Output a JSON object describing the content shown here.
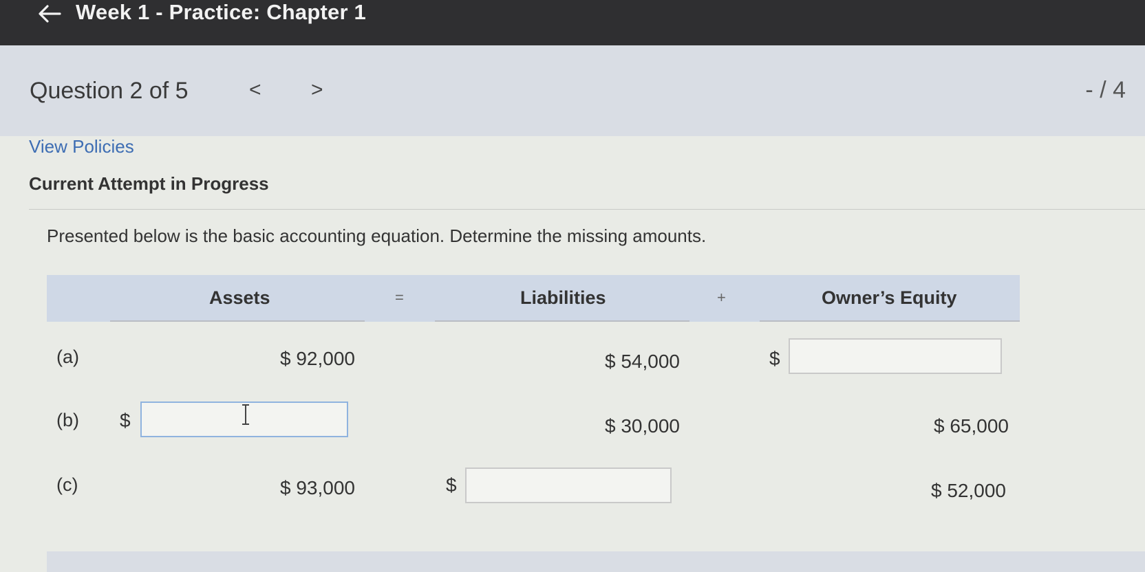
{
  "header": {
    "back_icon": "arrow-left-icon",
    "title": "Week 1 - Practice: Chapter 1"
  },
  "question_nav": {
    "label": "Question 2 of 5",
    "prev": "<",
    "next": ">",
    "score": "- / 4"
  },
  "links": {
    "view_policies": "View Policies"
  },
  "status": {
    "attempt": "Current Attempt in Progress"
  },
  "question": {
    "prompt": "Presented below is the basic accounting equation. Determine the missing amounts.",
    "columns": {
      "assets": "Assets",
      "equals": "=",
      "liabilities": "Liabilities",
      "plus": "+",
      "equity": "Owner’s Equity"
    },
    "rows": [
      {
        "label": "(a)",
        "assets": "$ 92,000",
        "liabilities": "$ 54,000",
        "equity_currency": "$",
        "equity_value": ""
      },
      {
        "label": "(b)",
        "assets_currency": "$",
        "assets_value": "",
        "liabilities": "$ 30,000",
        "equity": "$ 65,000"
      },
      {
        "label": "(c)",
        "assets": "$ 93,000",
        "liabilities_currency": "$",
        "liabilities_value": "",
        "equity": "$ 52,000"
      }
    ]
  },
  "colors": {
    "topbar": "#2f2f31",
    "link": "#3d6db3",
    "table_header": "#cfd8e6"
  }
}
